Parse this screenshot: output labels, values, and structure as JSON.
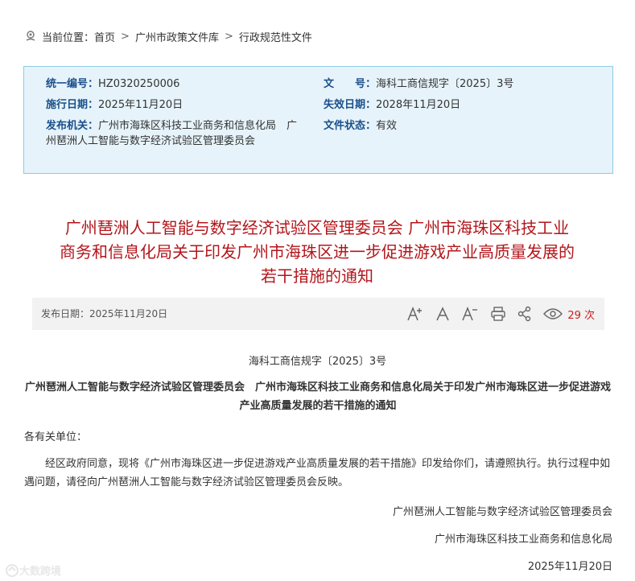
{
  "breadcrumb": {
    "prefix": "当前位置：",
    "items": [
      "首页",
      "广州市政策文件库",
      "行政规范性文件"
    ],
    "separator": ">"
  },
  "info": {
    "serial_label": "统一编号：",
    "serial_value": "HZ0320250006",
    "docno_label": "文　　号：",
    "docno_value": "海科工商信规字〔2025〕3号",
    "effective_label": "施行日期：",
    "effective_value": "2025年11月20日",
    "expiry_label": "失效日期：",
    "expiry_value": "2028年11月20日",
    "issuer_label": "发布机关：",
    "issuer_value": "广州市海珠区科技工业商务和信息化局　广州琶洲人工智能与数字经济试验区管理委员会",
    "status_label": "文件状态：",
    "status_value": "有效"
  },
  "title": "广州琶洲人工智能与数字经济试验区管理委员会 广州市海珠区科技工业商务和信息化局关于印发广州市海珠区进一步促进游戏产业高质量发展的若干措施的通知",
  "meta": {
    "publish_date": "发布日期：2025年11月20日",
    "tools": {
      "font_larger": "A⁺",
      "font_normal": "A",
      "font_smaller": "A⁻"
    },
    "view_count": "29 次"
  },
  "document": {
    "doc_number": "海科工商信规字〔2025〕3号",
    "subtitle": "广州琶洲人工智能与数字经济试验区管理委员会　广州市海珠区科技工业商务和信息化局关于印发广州市海珠区进一步促进游戏产业高质量发展的若干措施的通知",
    "addressee": "各有关单位：",
    "body": "经区政府同意，现将《广州市海珠区进一步促进游戏产业高质量发展的若干措施》印发给你们，请遵照执行。执行过程中如遇问题，请径向广州琶洲人工智能与数字经济试验区管理委员会反映。",
    "signatory_1": "广州琶洲人工智能与数字经济试验区管理委员会",
    "signatory_2": "广州市海珠区科技工业商务和信息化局",
    "sign_date": "2025年11月20日"
  },
  "watermark": "大数跨境",
  "colors": {
    "title_red": "#b3161b",
    "label_blue": "#1a4f8b",
    "info_bg": "#e6f3fa",
    "info_border": "#8ecae6",
    "meta_bg": "#f2f2f2",
    "views_red": "#c81e1e"
  },
  "icons": [
    "location-pin-icon",
    "font-increase-icon",
    "font-reset-icon",
    "font-decrease-icon",
    "print-icon",
    "share-icon",
    "eye-icon"
  ]
}
